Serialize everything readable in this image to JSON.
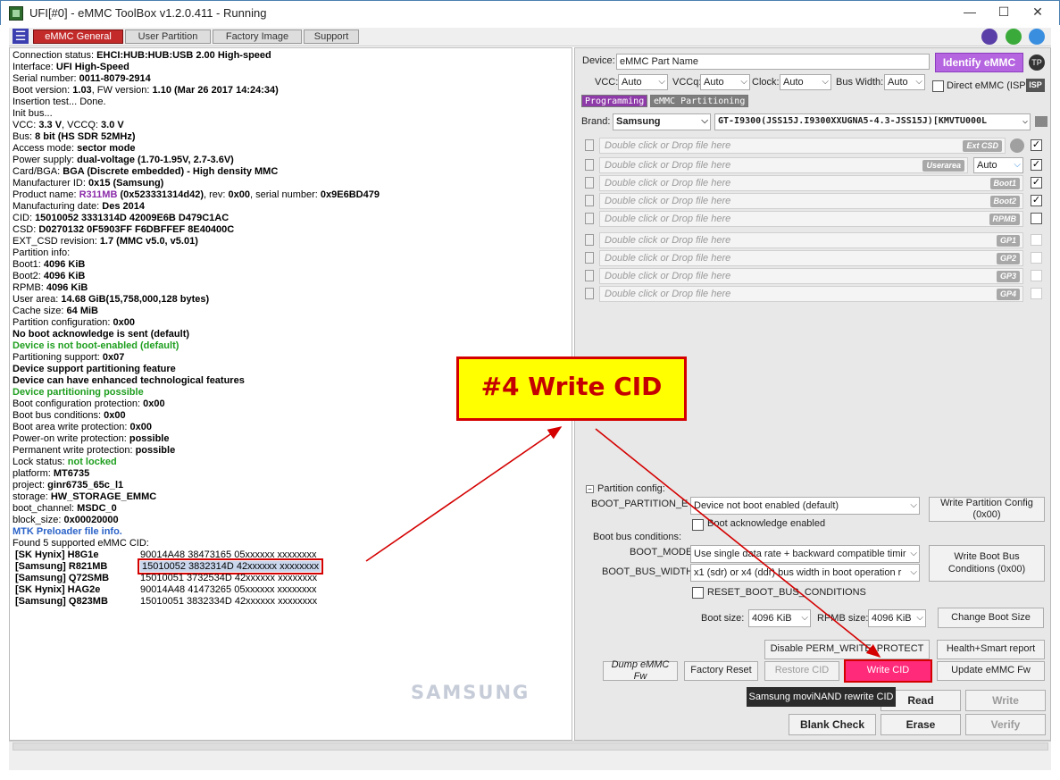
{
  "window": {
    "title": "UFI[#0] - eMMC ToolBox v1.2.0.411 - Running",
    "minimize": "—",
    "maximize": "☐",
    "close": "✕"
  },
  "tabs": [
    "eMMC General",
    "User Partition",
    "Factory Image",
    "Support"
  ],
  "info": {
    "connection": [
      "Connection status: ",
      "EHCI:HUB:HUB:USB 2.00 High-speed"
    ],
    "interface": [
      "Interface: ",
      "UFI High-Speed"
    ],
    "serial": [
      "Serial number: ",
      "0011-8079-2914"
    ],
    "boot_version": [
      "Boot version: ",
      "1.03",
      ", FW version: ",
      "1.10 (Mar 26 2017 14:24:34)"
    ],
    "insertion": "Insertion test... Done.",
    "init_bus": "Init bus...",
    "vcc": [
      " VCC: ",
      "3.3 V",
      ", VCCQ: ",
      "3.0 V"
    ],
    "bus": [
      " Bus: ",
      "8 bit (HS SDR 52MHz)"
    ],
    "access": [
      "Access mode: ",
      "sector mode"
    ],
    "power": [
      "Power supply: ",
      "dual-voltage (1.70-1.95V, 2.7-3.6V)"
    ],
    "card": [
      " Card/BGA: ",
      "BGA (Discrete embedded) - High density MMC"
    ],
    "manufacturer": [
      " Manufacturer ID: ",
      "0x15 (Samsung)"
    ],
    "product": [
      " Product name: ",
      "R311MB",
      " (0x523331314d42)",
      ", rev: ",
      "0x00",
      ", serial number: ",
      "0x9E6BD479"
    ],
    "mdate": [
      " Manufacturing date: ",
      "Des 2014"
    ],
    "cid": [
      "CID: ",
      "15010052 3331314D 42009E6B D479C1AC"
    ],
    "csd": [
      "CSD: ",
      "D0270132 0F5903FF F6DBFFEF 8E40400C"
    ],
    "ext_csd": [
      "EXT_CSD revision: ",
      "1.7 (MMC v5.0, v5.01)"
    ],
    "partition_info": "Partition info:",
    "boot1": [
      " Boot1: ",
      "4096 KiB"
    ],
    "boot2": [
      " Boot2: ",
      "4096 KiB"
    ],
    "rpmb": [
      " RPMB: ",
      "4096 KiB"
    ],
    "user_area": [
      " User area: ",
      "14.68 GiB(15,758,000,128 bytes)"
    ],
    "cache": [
      "Cache size: ",
      "64 MiB"
    ],
    "part_config": [
      "Partition configuration: ",
      "0x00"
    ],
    "no_boot_ack": " No boot acknowledge is sent (default)",
    "not_boot_enabled": " Device is not boot-enabled (default)",
    "part_support": [
      "Partitioning support: ",
      "0x07"
    ],
    "supports_part": " Device support partitioning feature",
    "enhanced": " Device can have enhanced technological features",
    "part_possible": " Device partitioning possible",
    "boot_cfg_prot": [
      "Boot configuration protection: ",
      "0x00"
    ],
    "boot_bus_cond": [
      "Boot bus conditions: ",
      "0x00"
    ],
    "boot_area_wp": [
      "Boot area write protection: ",
      "0x00"
    ],
    "power_on_wp": [
      " Power-on write protection: ",
      "possible"
    ],
    "perm_wp": [
      " Permanent write protection: ",
      "possible"
    ],
    "lock": [
      " Lock status: ",
      "not locked"
    ],
    "platform": [
      "platform: ",
      "MT6735"
    ],
    "project": [
      "project: ",
      "ginr6735_65c_l1"
    ],
    "storage": [
      "storage: ",
      "HW_STORAGE_EMMC"
    ],
    "boot_channel": [
      "boot_channel: ",
      "MSDC_0"
    ],
    "block_size": [
      "block_size: ",
      "0x00020000"
    ],
    "mtk": "MTK Preloader file info.",
    "found": "Found 5 supported eMMC CID:"
  },
  "cids": [
    {
      "name": "[SK Hynix] H8G1e",
      "value": "90014A48 38473165 05xxxxxx xxxxxxxx"
    },
    {
      "name": "[Samsung] R821MB",
      "value": "15010052 3832314D 42xxxxxx xxxxxxxx"
    },
    {
      "name": "[Samsung] Q72SMB",
      "value": "15010051 3732534D 42xxxxxx xxxxxxxx"
    },
    {
      "name": "[SK Hynix] HAG2e",
      "value": "90014A48 41473265 05xxxxxx xxxxxxxx"
    },
    {
      "name": "[Samsung] Q823MB",
      "value": "15010051 3832334D 42xxxxxx xxxxxxxx"
    }
  ],
  "samsung_logo": "SAMSUNG",
  "right": {
    "device_label": "Device:",
    "device_value": "eMMC Part Name",
    "identify": "Identify eMMC",
    "tp": "TP",
    "vcc_label": "VCC:",
    "vcc": "Auto",
    "vccq_label": "VCCq:",
    "vccq": "Auto",
    "clock_label": "Clock:",
    "clock": "Auto",
    "bus_label": "Bus Width:",
    "bus": "Auto",
    "direct_isp": "Direct eMMC (ISP)",
    "isp": "ISP",
    "prog_btn": "Programming",
    "part_btn": "eMMC Partitioning",
    "brand_label": "Brand:",
    "brand": "Samsung",
    "model": "GT-I9300(JSS15J.I9300XXUGNA5-4.3-JSS15J)[KMVTU000L",
    "drop_hint": "Double click or Drop file here",
    "userarea_type": "Auto",
    "partition_config_title": "Partition config:",
    "boot_partition_label": "BOOT_PARTITION_EN",
    "boot_partition_value": "Device not boot enabled (default)",
    "write_partition_config": "Write Partition Config (0x00)",
    "boot_ack": "Boot acknowledge enabled",
    "boot_bus_cond": "Boot bus conditions:",
    "boot_mode_label": "BOOT_MODE",
    "boot_mode_value": "Use single data rate + backward compatible timir",
    "boot_bus_width_label": "BOOT_BUS_WIDTH",
    "boot_bus_width_value": "x1 (sdr) or x4 (ddr) bus width in boot operation r",
    "write_boot_bus": "Write Boot Bus Conditions (0x00)",
    "reset_boot_bus": "RESET_BOOT_BUS_CONDITIONS",
    "boot_size_label": "Boot size:",
    "boot_size": "4096 KiB",
    "rpmb_size_label": "RPMB size:",
    "rpmb_size": "4096 KiB",
    "change_boot_size": "Change Boot Size",
    "disable_perm_wp": "Disable PERM_WRITE_PROTECT",
    "health_report": "Health+Smart report",
    "dump_fw": "Dump eMMC Fw",
    "factory_reset": "Factory Reset",
    "restore_cid": "Restore CID",
    "write_cid": "Write CID",
    "update_fw": "Update eMMC Fw",
    "read": "Read",
    "write": "Write",
    "blank_check": "Blank Check",
    "erase": "Erase",
    "verify": "Verify"
  },
  "partitions": [
    {
      "tag": "Ext CSD",
      "checked": true
    },
    {
      "tag": "Userarea",
      "checked": true
    },
    {
      "tag": "Boot1",
      "checked": true
    },
    {
      "tag": "Boot2",
      "checked": true
    },
    {
      "tag": "RPMB",
      "checked": false
    },
    {
      "tag": "GP1",
      "checked": false
    },
    {
      "tag": "GP2",
      "checked": false
    },
    {
      "tag": "GP3",
      "checked": false
    },
    {
      "tag": "GP4",
      "checked": false
    }
  ],
  "annotation": "#4 Write CID",
  "tooltip": "Samsung moviNAND rewrite CID",
  "colors": {
    "accent_red": "#d40000",
    "callout_bg": "#ffff00",
    "identify_bg": "#b565e0",
    "write_cid_bg": "#ff2a7a"
  }
}
